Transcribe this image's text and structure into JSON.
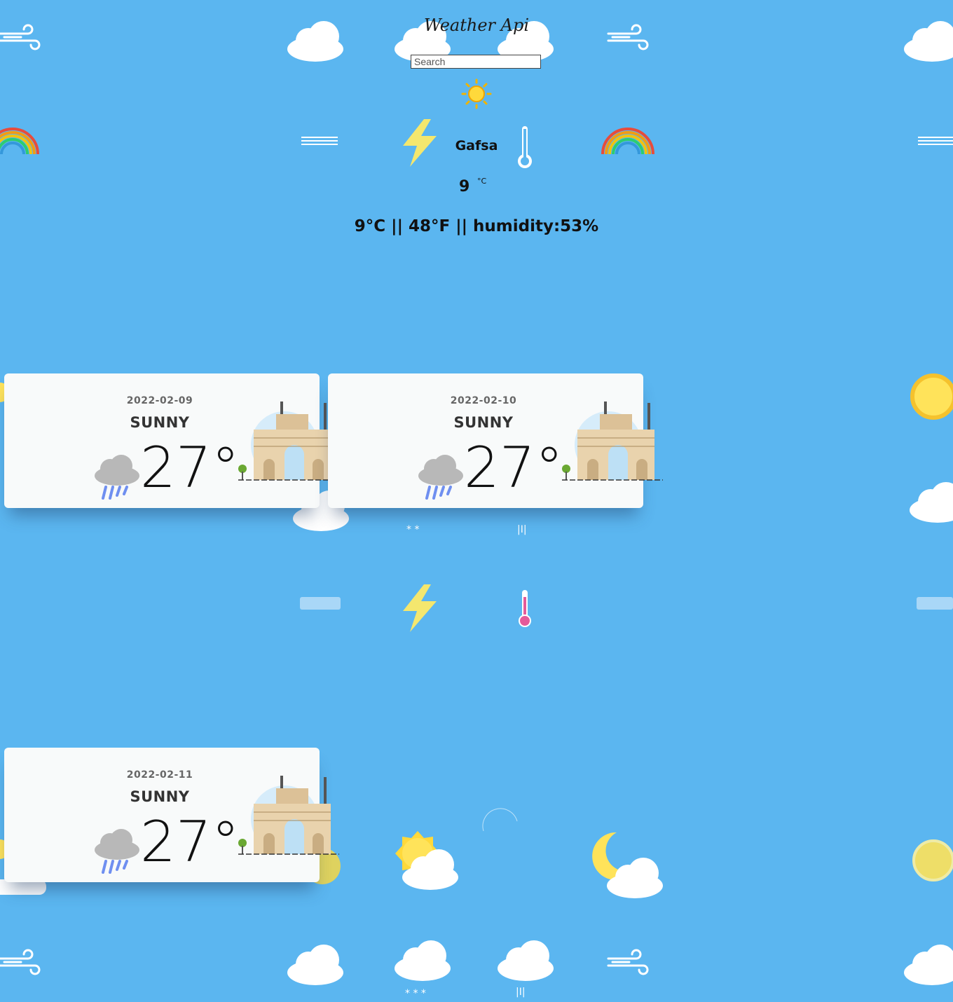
{
  "header": {
    "title": "Weather Api",
    "search_placeholder": "Search"
  },
  "current": {
    "city": "Gafsa",
    "temp": "9",
    "temp_unit": "°C",
    "summary": "9°C || 48°F || humidity:53%"
  },
  "forecast": [
    {
      "date": "2022-02-09",
      "condition": "SUNNY",
      "temp": "27°"
    },
    {
      "date": "2022-02-10",
      "condition": "SUNNY",
      "temp": "27°"
    },
    {
      "date": "2022-02-11",
      "condition": "SUNNY",
      "temp": "27°"
    }
  ],
  "icons": {
    "weather_small": "sun-icon",
    "storm": "lightning-icon",
    "thermometer": "thermometer-icon",
    "card_weather": "rain-cloud-icon",
    "card_landmark": "gateway-monument-icon"
  },
  "colors": {
    "background": "#5bb6f0",
    "card": "#f8fafa",
    "sun": "#ffd93b",
    "rain": "#6f8ff0"
  }
}
